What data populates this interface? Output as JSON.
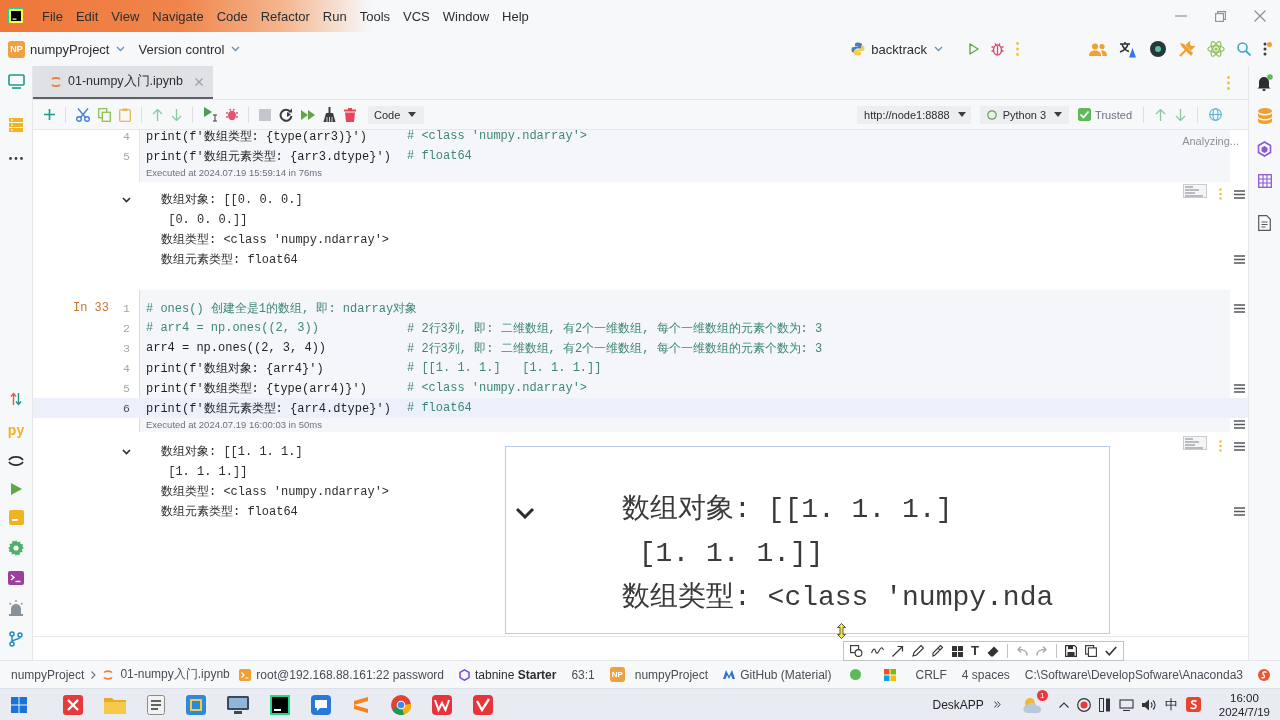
{
  "menu_bar": {
    "items": [
      "File",
      "Edit",
      "View",
      "Navigate",
      "Code",
      "Refactor",
      "Run",
      "Tools",
      "VCS",
      "Window",
      "Help"
    ]
  },
  "main_toolbar": {
    "project_badge": "NP",
    "project": "numpyProject",
    "version_control": "Version control",
    "run_configuration": "backtrack"
  },
  "left_toolbar": {
    "python_console": "py"
  },
  "editor_tabs": [
    {
      "label": "01-numpy入门.ipynb",
      "selected": true
    }
  ],
  "notebook_toolbar": {
    "cell_type": "Code",
    "server": "http://node1:8888",
    "kernel": "Python 3",
    "trusted": {
      "label": "Trusted",
      "checked": true
    }
  },
  "analysis_status": "Analyzing...",
  "cells": [
    {
      "lines": [
        {
          "number": "4",
          "current": false,
          "segments": [
            {
              "kind": "code",
              "text": "print(f'数组类型: {type(arr3)}')"
            },
            {
              "kind": "comment",
              "text": "# <class 'numpy.ndarray'>"
            }
          ]
        },
        {
          "number": "5",
          "current": false,
          "segments": [
            {
              "kind": "code",
              "text": "print(f'数组元素类型: {arr3.dtype}')"
            },
            {
              "kind": "comment",
              "text": "# float64"
            }
          ]
        }
      ],
      "executed": "Executed at 2024.07.19 15:59:14 in 76ms",
      "output_expanded": true,
      "output": [
        "数组对象: [[0. 0. 0.]",
        " [0. 0. 0.]]",
        "数组类型: <class 'numpy.ndarray'>",
        "数组元素类型: float64"
      ]
    },
    {
      "prompt": "In 33",
      "lines": [
        {
          "number": "1",
          "current": false,
          "segments": [
            {
              "kind": "comment",
              "text": "# ones() 创建全是1的数组, 即: ndarray对象"
            }
          ]
        },
        {
          "number": "2",
          "current": false,
          "segments": [
            {
              "kind": "comment",
              "text": "# arr4 = np.ones((2, 3))"
            },
            {
              "kind": "comment",
              "text": "# 2行3列, 即: 二维数组, 有2个一维数组, 每个一维数组的元素个数为: 3"
            }
          ]
        },
        {
          "number": "3",
          "current": false,
          "segments": [
            {
              "kind": "code",
              "text": "arr4 = np.ones((2, 3, 4))"
            },
            {
              "kind": "comment",
              "text": "# 2行3列, 即: 二维数组, 有2个一维数组, 每个一维数组的元素个数为: 3"
            }
          ]
        },
        {
          "number": "4",
          "current": false,
          "segments": [
            {
              "kind": "code",
              "text": "print(f'数组对象: {arr4}')"
            },
            {
              "kind": "comment",
              "text": "# [[1. 1. 1.]   [1. 1. 1.]]"
            }
          ]
        },
        {
          "number": "5",
          "current": false,
          "segments": [
            {
              "kind": "code",
              "text": "print(f'数组类型: {type(arr4)}')"
            },
            {
              "kind": "comment",
              "text": "# <class 'numpy.ndarray'>"
            }
          ]
        },
        {
          "number": "6",
          "current": true,
          "segments": [
            {
              "kind": "code",
              "text": "print(f'数组元素类型: {arr4.dtype}')"
            },
            {
              "kind": "comment",
              "text": "# float64"
            }
          ]
        }
      ],
      "executed": "Executed at 2024.07.19 16:00:03 in 50ms",
      "output_expanded": true,
      "output": [
        "数组对象: [[1. 1. 1.]",
        " [1. 1. 1.]]",
        "数组类型: <class 'numpy.ndarray'>",
        "数组元素类型: float64"
      ]
    }
  ],
  "magnifier": {
    "output_expanded": true,
    "lines": [
      "数组对象: [[1. 1. 1.]",
      " [1. 1. 1.]]",
      "数组类型: <class 'numpy.nda"
    ]
  },
  "annotation_toolbar": {
    "text_tool": "T"
  },
  "status_bar": {
    "breadcrumbs": [
      "numpyProject",
      "01-numpy入门.ipynb"
    ],
    "connection": "root@192.168.88.161:22 password",
    "plugin": "tabnine **Starter**",
    "position": "63:1",
    "interpreter_badge": "NP",
    "interpreter": "numpyProject",
    "theme": "GitHub (Material)",
    "line_separator": "CRLF",
    "indent": "4 spaces",
    "path": "C:\\Software\\DevelopSofware\\Anaconda3"
  },
  "taskbar": {
    "pinned_label": "DeskAPP",
    "notification_badge": "1",
    "input_method": "中",
    "time": "16:00",
    "date": "2024/7/19"
  }
}
